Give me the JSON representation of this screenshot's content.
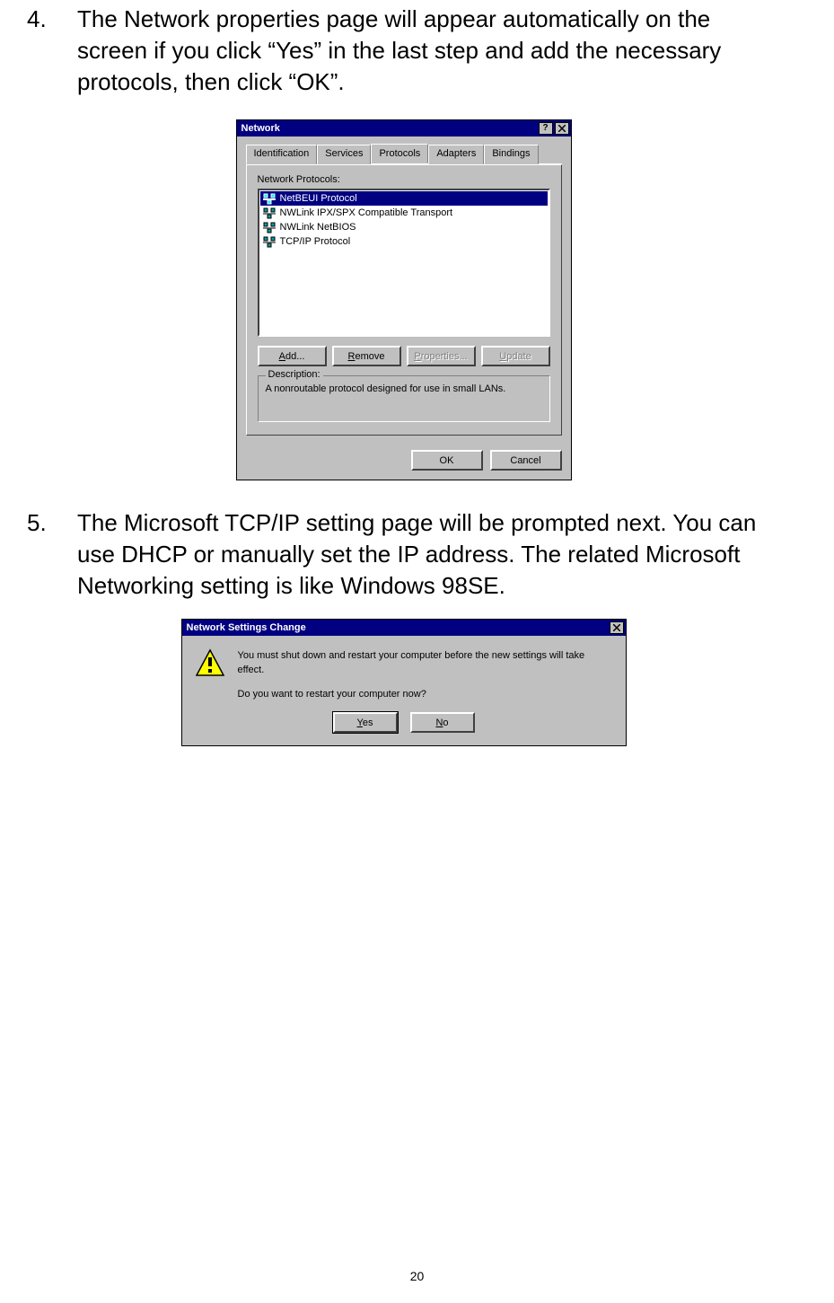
{
  "steps": {
    "s4_num": "4.",
    "s4_text": "The Network properties page will appear automatically on the screen if you click “Yes” in the last step and add the necessary protocols, then click “OK”.",
    "s5_num": "5.",
    "s5_text": "The Microsoft TCP/IP setting page will be prompted next. You can use DHCP or manually set the IP address. The related Microsoft Networking setting is like Windows 98SE."
  },
  "dlg1": {
    "title": "Network",
    "tabs": {
      "t0": "Identification",
      "t1": "Services",
      "t2": "Protocols",
      "t3": "Adapters",
      "t4": "Bindings"
    },
    "list_label": "Network Protocols:",
    "items": {
      "i0": "NetBEUI Protocol",
      "i1": "NWLink IPX/SPX Compatible Transport",
      "i2": "NWLink NetBIOS",
      "i3": "TCP/IP Protocol"
    },
    "buttons": {
      "add_pre": "A",
      "add_post": "dd...",
      "rem_pre": "R",
      "rem_post": "emove",
      "prop_pre": "P",
      "prop_post": "roperties...",
      "upd_pre": "U",
      "upd_post": "pdate"
    },
    "desc_label": "Description:",
    "desc_text": "A nonroutable protocol designed for use in small LANs.",
    "ok": "OK",
    "cancel": "Cancel"
  },
  "dlg2": {
    "title": "Network Settings Change",
    "line1": "You must shut down and restart your computer before the new settings will take effect.",
    "line2": "Do you want to restart your computer now?",
    "yes_pre": "Y",
    "yes_post": "es",
    "no_pre": "N",
    "no_post": "o"
  },
  "page_number": "20"
}
